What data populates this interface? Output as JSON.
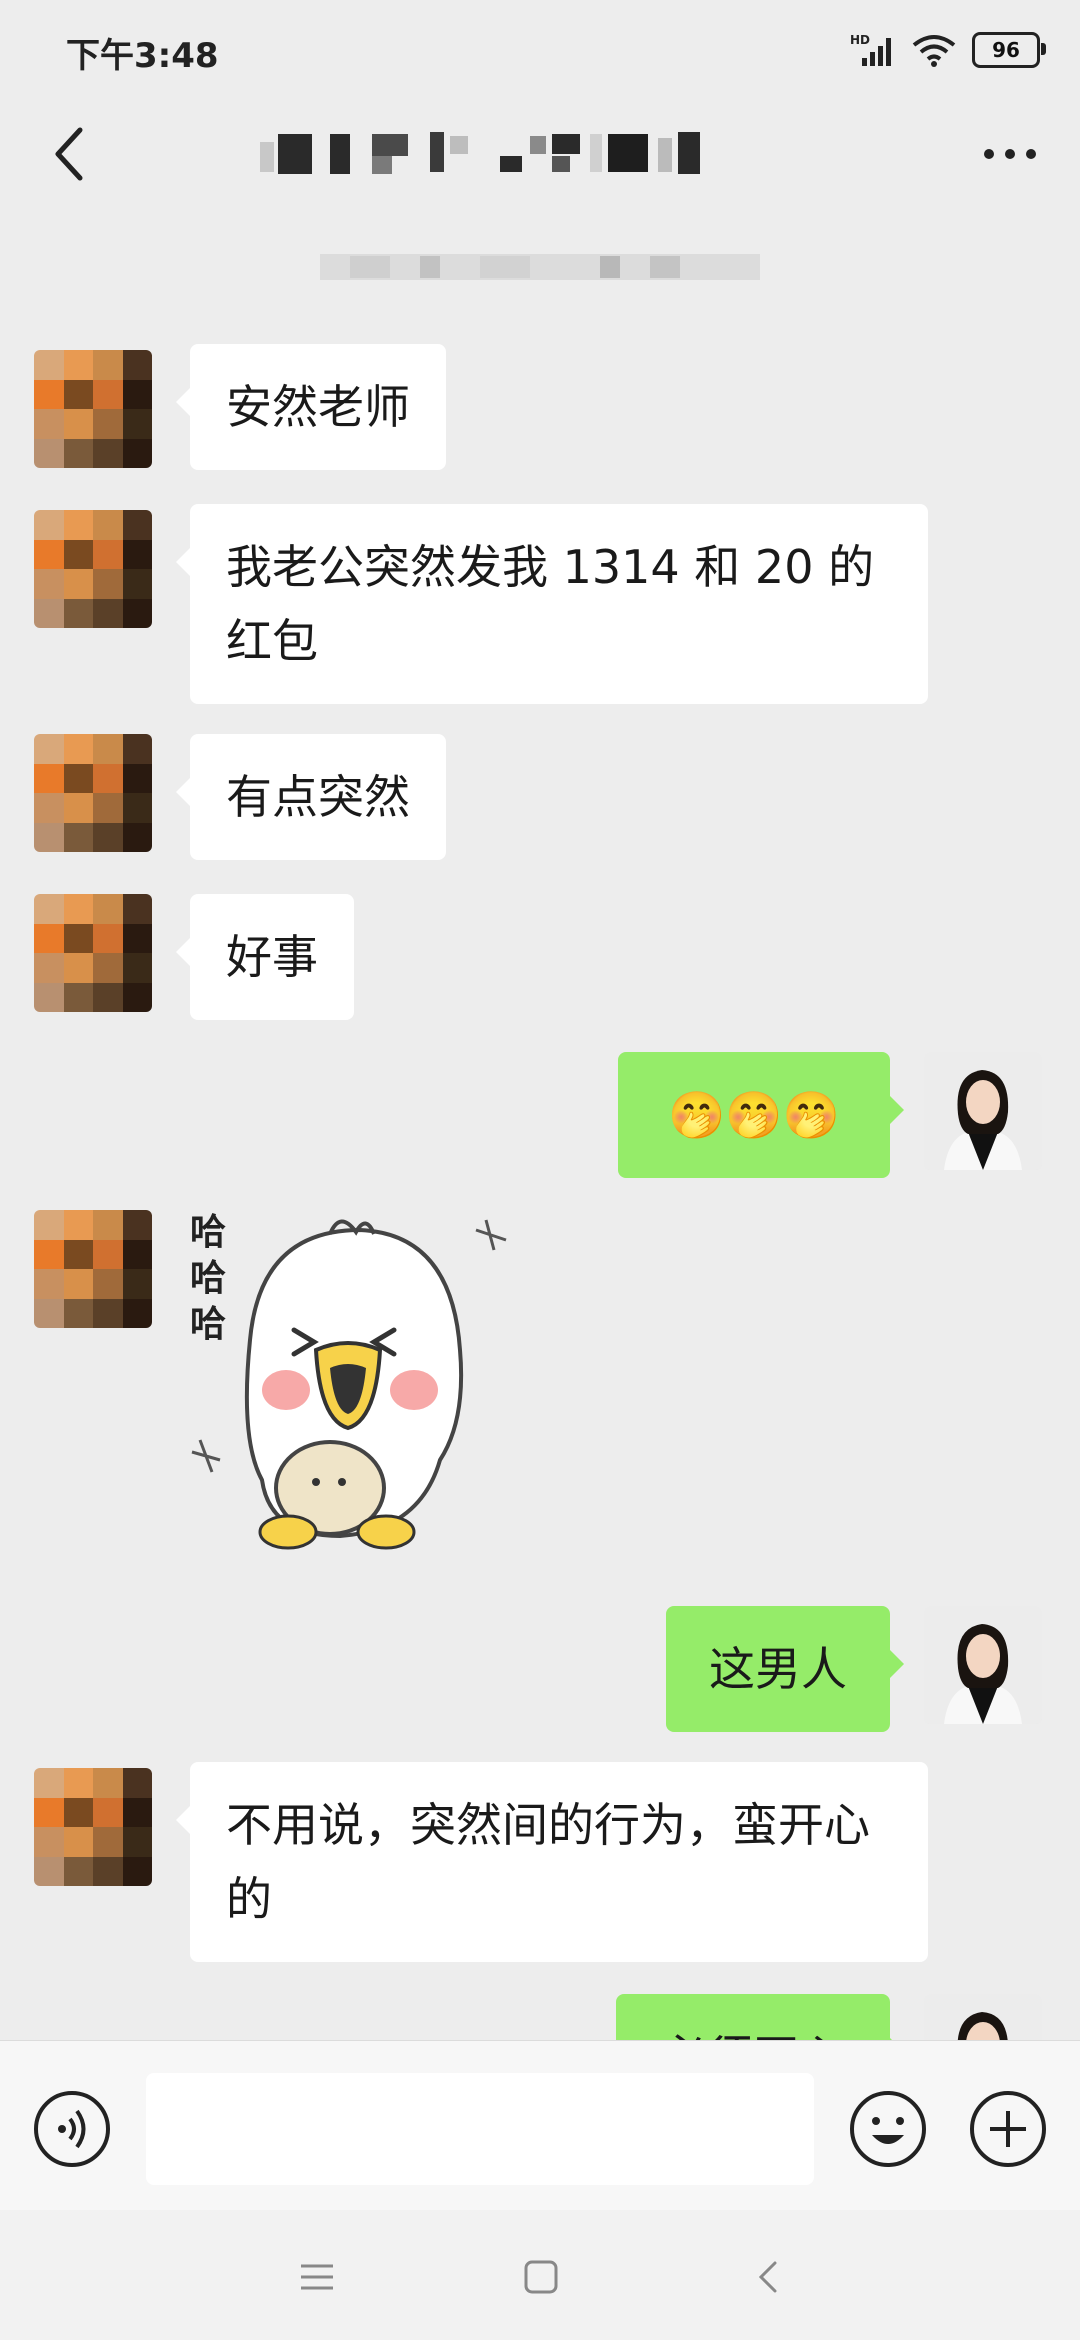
{
  "status_bar": {
    "time": "下午3:48",
    "network": "HD",
    "battery": "96"
  },
  "header": {
    "back_icon": "chevron-left-icon",
    "more_icon": "more-dots-icon"
  },
  "messages": [
    {
      "side": "in",
      "type": "text",
      "text": "安然老师"
    },
    {
      "side": "in",
      "type": "text",
      "text": "我老公突然发我 1314 和 20 的红包"
    },
    {
      "side": "in",
      "type": "text",
      "text": "有点突然"
    },
    {
      "side": "in",
      "type": "text",
      "text": "好事"
    },
    {
      "side": "out",
      "type": "text",
      "text": "🤭🤭🤭"
    },
    {
      "side": "in",
      "type": "sticker",
      "sticker_text": "哈哈哈",
      "sticker": "laughing-duck-sticker"
    },
    {
      "side": "out",
      "type": "text",
      "text": "这男人"
    },
    {
      "side": "in",
      "type": "text",
      "text": "不用说，突然间的行为，蛮开心的"
    },
    {
      "side": "out",
      "type": "text",
      "text": "必须开心"
    }
  ],
  "input_bar": {
    "placeholder": "",
    "voice_icon": "voice-icon",
    "emoji_icon": "emoji-icon",
    "plus_icon": "plus-icon"
  },
  "nav_bar": {
    "menu_icon": "menu-icon",
    "home_icon": "home-icon",
    "back_icon": "back-icon"
  },
  "colors": {
    "background": "#ededed",
    "bubble_in": "#ffffff",
    "bubble_out": "#95ec69"
  }
}
